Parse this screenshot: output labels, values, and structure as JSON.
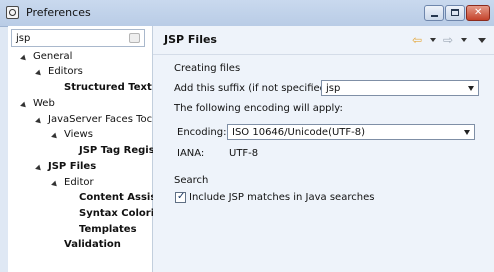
{
  "window": {
    "title": "Preferences"
  },
  "filter": {
    "value": "jsp"
  },
  "tree": [
    {
      "label": "General",
      "bold": false,
      "expanded": true
    },
    {
      "label": "Editors",
      "bold": false,
      "expanded": true
    },
    {
      "label": "Structured Text E",
      "bold": true
    },
    {
      "label": "Web",
      "bold": false,
      "expanded": true
    },
    {
      "label": "JavaServer Faces Toc",
      "bold": false,
      "expanded": true
    },
    {
      "label": "Views",
      "bold": false,
      "expanded": true
    },
    {
      "label": "JSP Tag Regis",
      "bold": true
    },
    {
      "label": "JSP Files",
      "bold": true,
      "expanded": true
    },
    {
      "label": "Editor",
      "bold": false,
      "expanded": true
    },
    {
      "label": "Content Assis",
      "bold": true
    },
    {
      "label": "Syntax Colori",
      "bold": true
    },
    {
      "label": "Templates",
      "bold": true
    },
    {
      "label": "Validation",
      "bold": true
    }
  ],
  "page": {
    "title": "JSP Files",
    "creating_files_label": "Creating files",
    "suffix_label": "Add this suffix (if not specified):",
    "suffix_value": "jsp",
    "encoding_note": "The following encoding will apply:",
    "encoding_label": "Encoding:",
    "encoding_value": "ISO 10646/Unicode(UTF-8)",
    "iana_label": "IANA:",
    "iana_value": "UTF-8",
    "search_label": "Search",
    "include_jsp_label": "Include JSP matches in Java searches",
    "include_jsp_checked": true
  }
}
